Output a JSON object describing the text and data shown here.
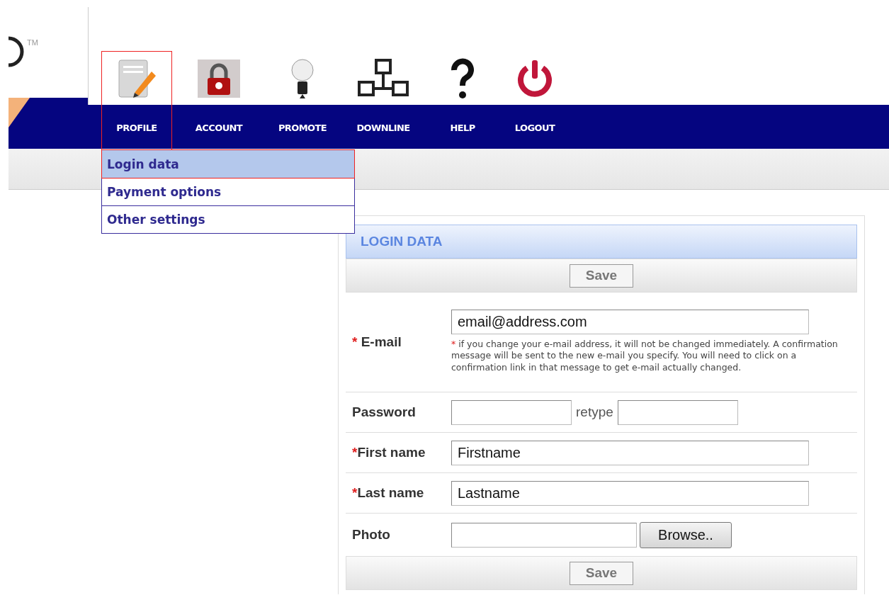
{
  "logo": {
    "trademark": "TM"
  },
  "nav": [
    {
      "label": "PROFILE",
      "selected": true
    },
    {
      "label": "ACCOUNT",
      "selected": false
    },
    {
      "label": "PROMOTE",
      "selected": false
    },
    {
      "label": "DOWNLINE",
      "selected": false
    },
    {
      "label": "HELP",
      "selected": false
    },
    {
      "label": "LOGOUT",
      "selected": false
    }
  ],
  "dropdown": [
    {
      "label": "Login data",
      "selected": true
    },
    {
      "label": "Payment options",
      "selected": false
    },
    {
      "label": "Other settings",
      "selected": false
    }
  ],
  "form": {
    "title": "LOGIN DATA",
    "save_top": "Save",
    "save_bottom": "Save",
    "fields": [
      {
        "kind": "email",
        "mark": "*",
        "label": "E-mail",
        "value": "email@address.com",
        "note_mark": "*",
        "note": "if you change your e-mail address, it will not be changed immediately. A confirmation message will be sent to the new e-mail you specify. You will need to click on a confirmation link in that message to get e-mail actually changed."
      },
      {
        "kind": "password",
        "label": "Password",
        "retype": "retype"
      },
      {
        "kind": "text",
        "mark": "*",
        "label": "First name",
        "value": "Firstname"
      },
      {
        "kind": "text",
        "mark": "*",
        "label": "Last name",
        "value": "Lastname"
      },
      {
        "kind": "file",
        "label": "Photo",
        "button": "Browse.."
      }
    ]
  }
}
